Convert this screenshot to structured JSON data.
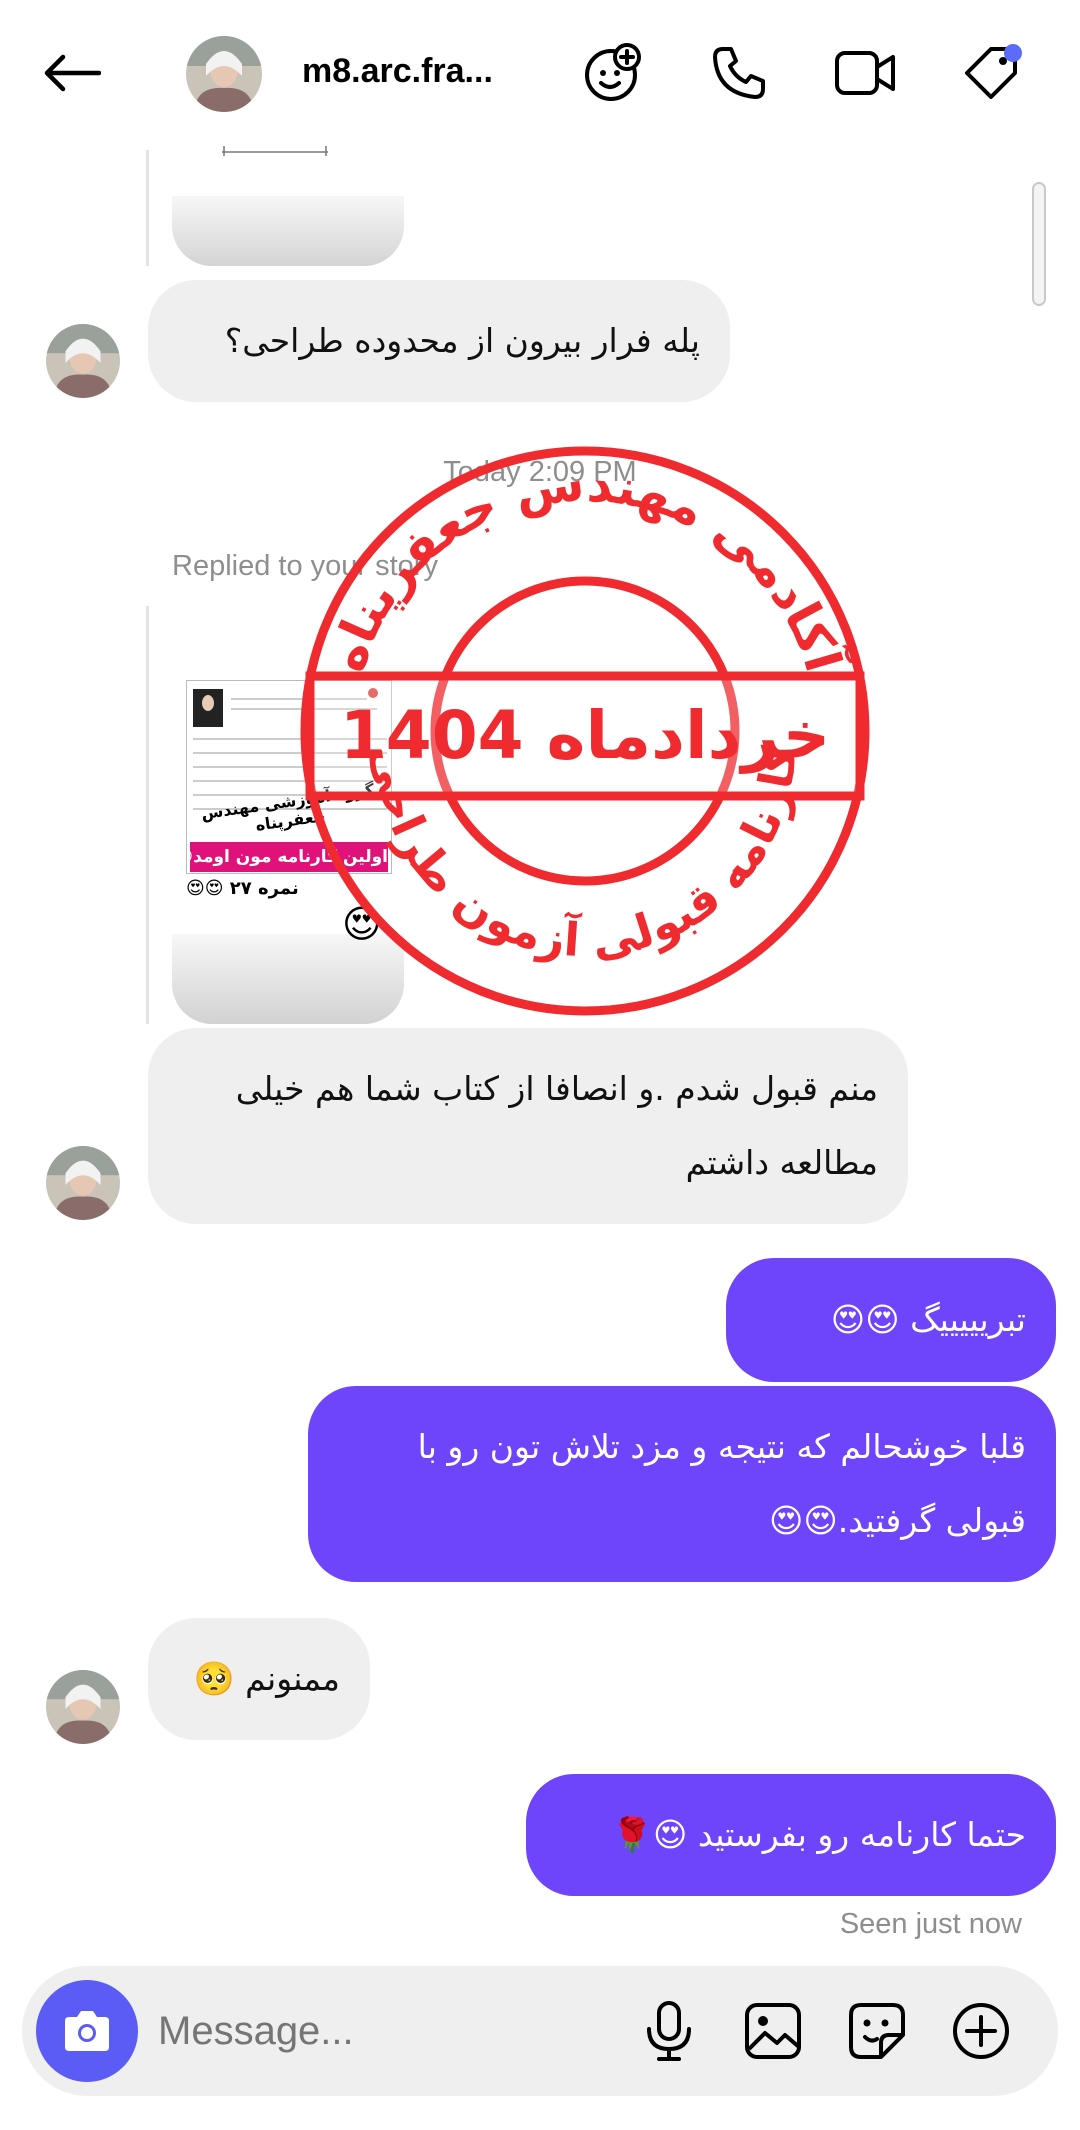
{
  "header": {
    "username": "m8.arc.fra...",
    "has_notification_dot": true
  },
  "timeline": {
    "timestamp": "Today 2:09 PM",
    "replied_label": "Replied to your story",
    "seen_label": "Seen just now"
  },
  "messages": [
    {
      "side": "in",
      "text": "پله فرار بیرون از محدوده طراحی؟"
    },
    {
      "side": "in",
      "text": "منم قبول شدم .و انصافا از کتاب شما هم خیلی مطالعه داشتم"
    },
    {
      "side": "out",
      "text": "تبریییییگ 😍😍"
    },
    {
      "side": "out",
      "text": "قلبا خوشحالم که نتیجه و مزد تلاش تون رو با قبولی گرفتید.😍😍"
    },
    {
      "side": "in",
      "text": "ممنونم 🥺"
    },
    {
      "side": "out",
      "text": "حتما کارنامه رو بفرستید 😍🌹"
    }
  ],
  "story_preview": {
    "caption_group": "گروه آموزشی مهندس جعفرپناه",
    "caption_highlight": "اولین کارنامه مون اومد😍",
    "caption_score": "نمره ۲۷ 😍😍",
    "reaction": "😍"
  },
  "stamp": {
    "top_text": "آکادمی مهندس جعفرپناه",
    "center_text": "خردادماه 1404",
    "bottom_text": "کارنامه قبولی آزمون طراحی",
    "color": "#ef2b30"
  },
  "composer": {
    "placeholder": "Message..."
  },
  "colors": {
    "outgoing_bubble": "#6e45fa",
    "incoming_bubble": "#efefef",
    "camera_button": "#5b5cf6",
    "notification_dot": "#5b6df8"
  },
  "icons": [
    "back-arrow-icon",
    "effects-icon",
    "phone-icon",
    "video-camera-icon",
    "tag-icon",
    "camera-icon",
    "microphone-icon",
    "gallery-icon",
    "sticker-icon",
    "plus-icon"
  ]
}
